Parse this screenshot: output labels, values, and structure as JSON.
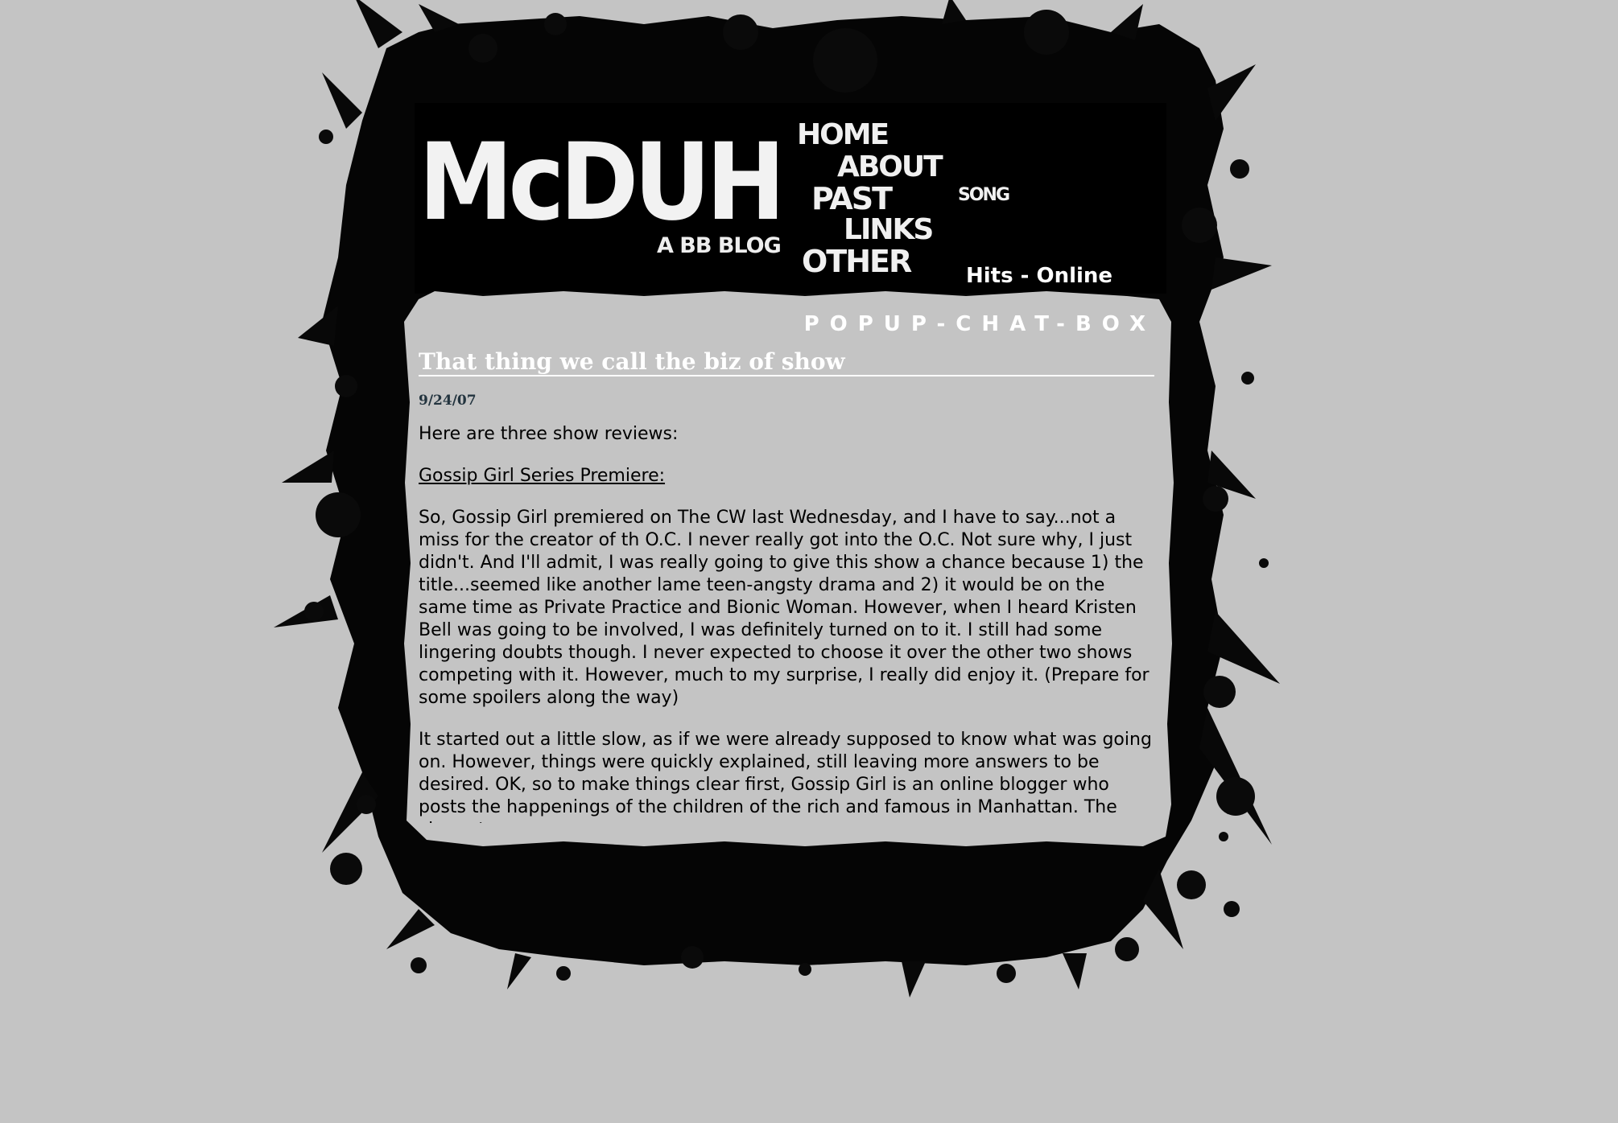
{
  "header": {
    "logo": "McDUH",
    "tagline": "A BB BLOG",
    "nav": {
      "home": "HOME",
      "about": "ABOUT",
      "past": "PAST",
      "links": "LINKS",
      "other": "OTHER",
      "song": "SONG"
    },
    "hits": "Hits - Online",
    "popup_chat": "POPUP-CHAT-BOX"
  },
  "post": {
    "title": "That thing we call the biz of show",
    "date": "9/24/07",
    "intro": "Here are three show reviews:",
    "section_heading": "Gossip Girl Series Premiere:",
    "paragraph_1": "So, Gossip Girl premiered on The CW last Wednesday, and I have to say...not a miss for the creator of th O.C. I never really got into the O.C. Not sure why, I just didn't. And I'll admit, I was really going to give this show a chance because 1) the title...seemed like another lame teen-angsty drama and 2) it would be on the same time as Private Practice and Bionic Woman. However, when I heard Kristen Bell was going to be involved, I was definitely turned on to it. I still had some lingering doubts though. I never expected to choose it over the other two shows competing with it. However, much to my surprise, I really did enjoy it. (Prepare for some spoilers along the way)",
    "paragraph_2": "It started out a little slow, as if we were already supposed to know what was going on. However, things were quickly explained, still leaving more answers to be desired. OK, so to make things clear first, Gossip Girl is an online blogger who posts the happenings of the children of the rich and famous in Manhattan. The characters"
  }
}
